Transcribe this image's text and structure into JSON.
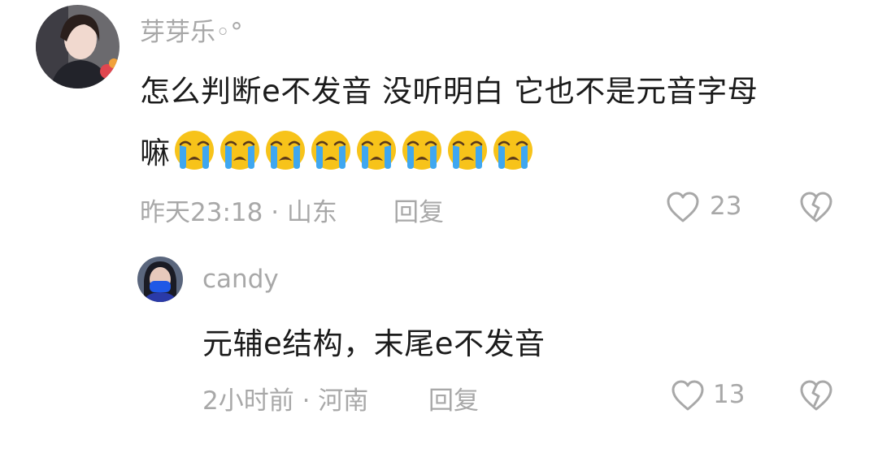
{
  "comments": [
    {
      "username": "芽芽乐◦°",
      "text": "怎么判断e不发音 没听明白 它也不是元音字母",
      "text_line2_prefix": "嘛",
      "emojis": [
        "crying-face",
        "crying-face",
        "crying-face",
        "crying-face",
        "crying-face",
        "crying-face",
        "crying-face",
        "crying-face"
      ],
      "time_location": "昨天23:18 · 山东",
      "reply_label": "回复",
      "likes": "23"
    }
  ],
  "replies": [
    {
      "username": "candy",
      "text": "元辅e结构，末尾e不发音",
      "time_location": "2小时前 · 河南",
      "reply_label": "回复",
      "likes": "13"
    }
  ],
  "icons": {
    "like": "heart-outline-icon",
    "dislike": "broken-heart-icon"
  },
  "colors": {
    "muted_text": "#a8a8a8",
    "main_text": "#1b1b1b",
    "emoji_face": "#f7c31a"
  }
}
